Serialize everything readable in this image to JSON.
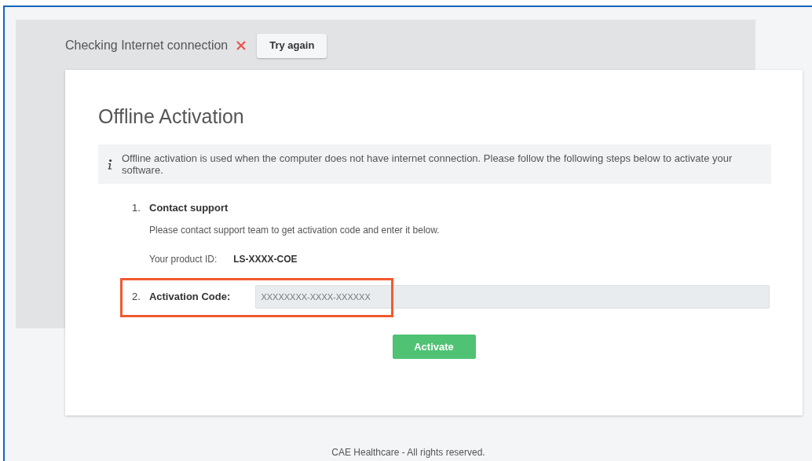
{
  "connection_status": {
    "label": "Checking Internet connection",
    "failed": true,
    "retry_button": "Try again"
  },
  "card": {
    "title": "Offline Activation",
    "info": "Offline activation is used when the computer does not have internet connection. Please follow the following steps below to activate your software.",
    "steps": [
      {
        "kind": "text",
        "number": "1.",
        "title": "Contact support",
        "description": "Please contact support team to get activation code and enter it below.",
        "product_id_label": "Your product ID:",
        "product_id": "LS-XXXX-COE"
      },
      {
        "kind": "input",
        "number": "2.",
        "title": "Activation Code:",
        "placeholder": "XXXXXXXX-XXXX-XXXXXX",
        "highlighted": true
      }
    ],
    "activate_button": "Activate"
  },
  "footer": "CAE Healthcare - All rights reserved."
}
